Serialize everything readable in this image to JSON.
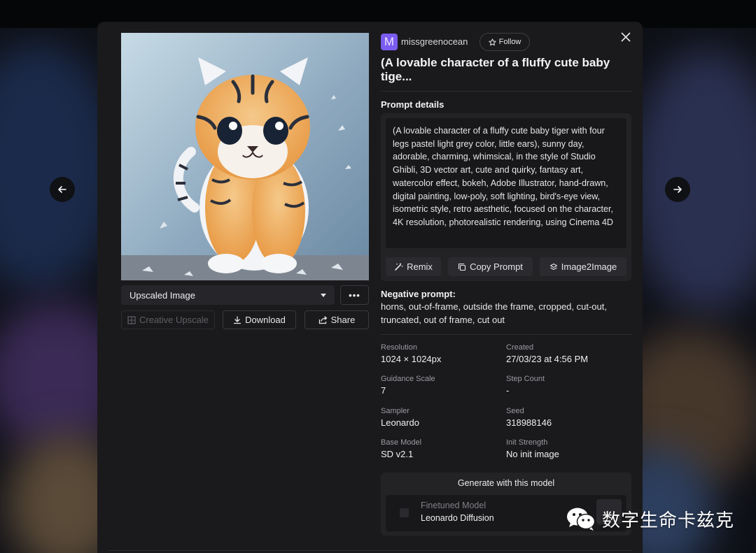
{
  "navigation": {
    "prev_icon": "arrow-left-icon",
    "next_icon": "arrow-right-icon",
    "close_icon": "close-icon"
  },
  "image_panel": {
    "variant_select": "Upscaled Image",
    "more_label": "•••",
    "creative_upscale_label": "Creative Upscale",
    "download_label": "Download",
    "share_label": "Share"
  },
  "author": {
    "avatar_letter": "M",
    "username": "missgreenocean",
    "follow_label": "Follow"
  },
  "title": "(A lovable character of a fluffy cute baby tige...",
  "prompt": {
    "label": "Prompt details",
    "text": "(A lovable character of a fluffy cute baby tiger with four legs pastel light grey color, little ears), sunny day, adorable, charming, whimsical, in the style of Studio Ghibli, 3D vector art, cute and quirky, fantasy art, watercolor effect, bokeh, Adobe Illustrator, hand-drawn, digital painting, low-poly, soft lighting, bird's-eye view, isometric style, retro aesthetic, focused on the character, 4K resolution, photorealistic rendering, using Cinema 4D",
    "remix_label": "Remix",
    "copy_label": "Copy Prompt",
    "image2image_label": "Image2Image"
  },
  "negative_prompt": {
    "label": "Negative prompt:",
    "text": "horns, out-of-frame, outside the frame, cropped, cut-out, truncated, out of frame, cut out"
  },
  "metadata": [
    {
      "key": "Resolution",
      "value": "1024 × 1024px"
    },
    {
      "key": "Created",
      "value": "27/03/23 at 4:56 PM"
    },
    {
      "key": "Guidance Scale",
      "value": "7"
    },
    {
      "key": "Step Count",
      "value": "-"
    },
    {
      "key": "Sampler",
      "value": "Leonardo"
    },
    {
      "key": "Seed",
      "value": "318988146"
    },
    {
      "key": "Base Model",
      "value": "SD v2.1"
    },
    {
      "key": "Init Strength",
      "value": "No init image"
    }
  ],
  "generate": {
    "title": "Generate with this model",
    "model_type": "Finetuned Model",
    "model_name": "Leonardo Diffusion"
  },
  "watermark": {
    "text": "数字生命卡兹克",
    "icon": "wechat-icon"
  },
  "colors": {
    "accent": "#7b5cf0",
    "modal_bg": "#1a1a1c",
    "panel_bg": "#232326"
  }
}
